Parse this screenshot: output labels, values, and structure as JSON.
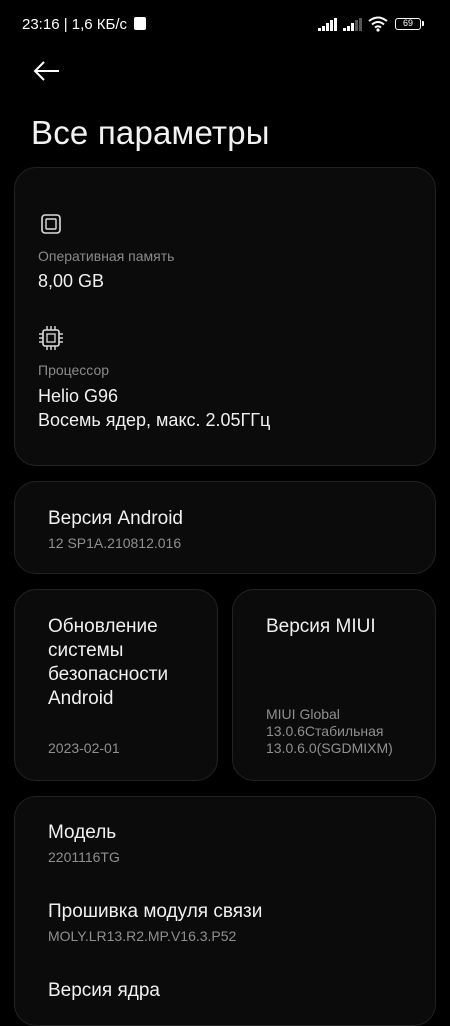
{
  "status_bar": {
    "text": "23:16 | 1,6 КБ/с",
    "battery": "69"
  },
  "header": {
    "title": "Все параметры"
  },
  "specs": {
    "ram_label": "Оперативная память",
    "ram_value": "8,00 GB",
    "cpu_label": "Процессор",
    "cpu_value_line1": "Helio G96",
    "cpu_value_line2": "Восемь ядер, макс. 2.05ГГц"
  },
  "android": {
    "title": "Версия Android",
    "value": "12 SP1A.210812.016"
  },
  "security": {
    "title_lines": [
      "Обновление",
      "системы",
      "безопасности",
      "Android"
    ],
    "value": "2023-02-01"
  },
  "miui": {
    "title": "Версия MIUI",
    "value_lines": [
      "MIUI Global",
      "13.0.6Стабильная",
      "13.0.6.0(SGDMIXM)"
    ]
  },
  "details": {
    "model_title": "Модель",
    "model_value": "2201116TG",
    "baseband_title": "Прошивка модуля связи",
    "baseband_value": "MOLY.LR13.R2.MP.V16.3.P52",
    "kernel_title": "Версия ядра"
  }
}
